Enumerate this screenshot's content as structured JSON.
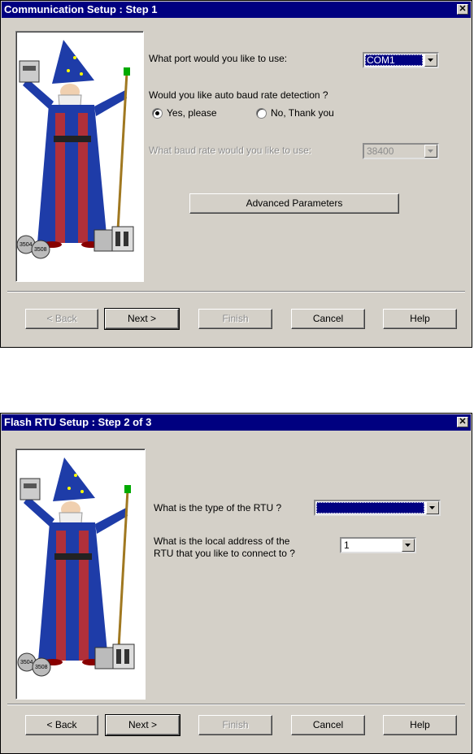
{
  "dialog1": {
    "title": "Communication Setup : Step 1",
    "close_glyph": "✕",
    "port_label": "What port would you like to use:",
    "port_value": "COM1",
    "auto_baud_label": "Would you like auto baud rate detection ?",
    "radio_yes": "Yes, please",
    "radio_no": "No, Thank you",
    "baud_label": "What baud rate would you like to use:",
    "baud_value": "38400",
    "advanced_button": "Advanced Parameters",
    "buttons": {
      "back": "< Back",
      "next": "Next >",
      "finish": "Finish",
      "cancel": "Cancel",
      "help": "Help"
    }
  },
  "dialog2": {
    "title": "Flash RTU Setup : Step 2 of 3",
    "close_glyph": "✕",
    "rtu_type_label": "What is the type of the RTU ?",
    "rtu_type_value": "",
    "address_label_line1": "What is the local address of the",
    "address_label_line2": "RTU that you like to connect to ?",
    "address_value": "1",
    "buttons": {
      "back": "< Back",
      "next": "Next >",
      "finish": "Finish",
      "cancel": "Cancel",
      "help": "Help"
    }
  },
  "wizard_image": {
    "badge_left": "3504",
    "badge_right": "3508"
  },
  "colors": {
    "titlebar": "#000080",
    "face": "#d4d0c8",
    "robe": "#1e3ca8",
    "robe_red": "#b0303a"
  }
}
